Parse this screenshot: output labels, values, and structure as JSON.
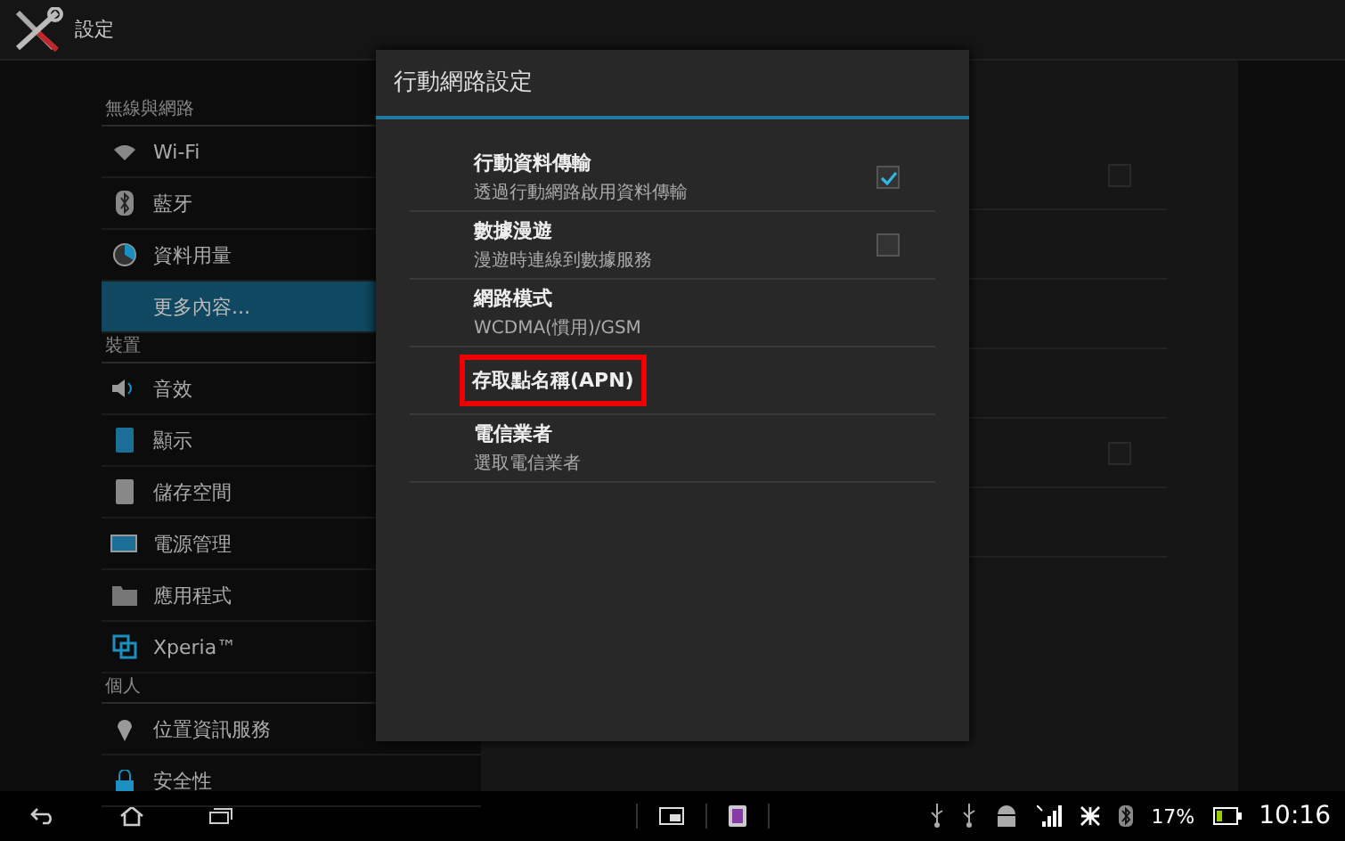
{
  "action_bar": {
    "title": "設定"
  },
  "sidebar": {
    "sections": [
      {
        "header": "無線與網路",
        "items": [
          {
            "label": "Wi-Fi",
            "kind": "wifi",
            "selected": false
          },
          {
            "label": "藍牙",
            "kind": "bluetooth",
            "selected": false
          },
          {
            "label": "資料用量",
            "kind": "usage",
            "selected": false
          },
          {
            "label": "更多內容...",
            "kind": "text",
            "selected": true
          }
        ]
      },
      {
        "header": "裝置",
        "items": [
          {
            "label": "音效",
            "kind": "sound",
            "selected": false
          },
          {
            "label": "顯示",
            "kind": "display",
            "selected": false
          },
          {
            "label": "儲存空間",
            "kind": "storage",
            "selected": false
          },
          {
            "label": "電源管理",
            "kind": "power",
            "selected": false
          },
          {
            "label": "應用程式",
            "kind": "apps",
            "selected": false
          },
          {
            "label": "Xperia™",
            "kind": "xperia",
            "selected": false
          }
        ]
      },
      {
        "header": "個人",
        "items": [
          {
            "label": "位置資訊服務",
            "kind": "location",
            "selected": false
          },
          {
            "label": "安全性",
            "kind": "security",
            "selected": false
          }
        ]
      }
    ]
  },
  "detail_pane": {
    "rows": [
      {
        "kind": "checkbox",
        "checked": false
      },
      {
        "kind": "plain"
      },
      {
        "kind": "plain"
      },
      {
        "kind": "plain"
      },
      {
        "kind": "checkbox",
        "checked": false
      },
      {
        "kind": "plain"
      }
    ]
  },
  "dialog": {
    "title": "行動網路設定",
    "items": [
      {
        "kind": "checkbox",
        "title": "行動資料傳輸",
        "summary": "透過行動網路啟用資料傳輸",
        "checked": true,
        "highlighted": false
      },
      {
        "kind": "checkbox",
        "title": "數據漫遊",
        "summary": "漫遊時連線到數據服務",
        "checked": false,
        "highlighted": false
      },
      {
        "kind": "plain",
        "title": "網路模式",
        "summary": "WCDMA(慣用)/GSM",
        "highlighted": false
      },
      {
        "kind": "plain",
        "title": "存取點名稱(APN)",
        "highlighted": true
      },
      {
        "kind": "plain",
        "title": "電信業者",
        "summary": "選取電信業者",
        "highlighted": false
      }
    ]
  },
  "status_bar": {
    "battery": "17%",
    "time": "10:16"
  }
}
